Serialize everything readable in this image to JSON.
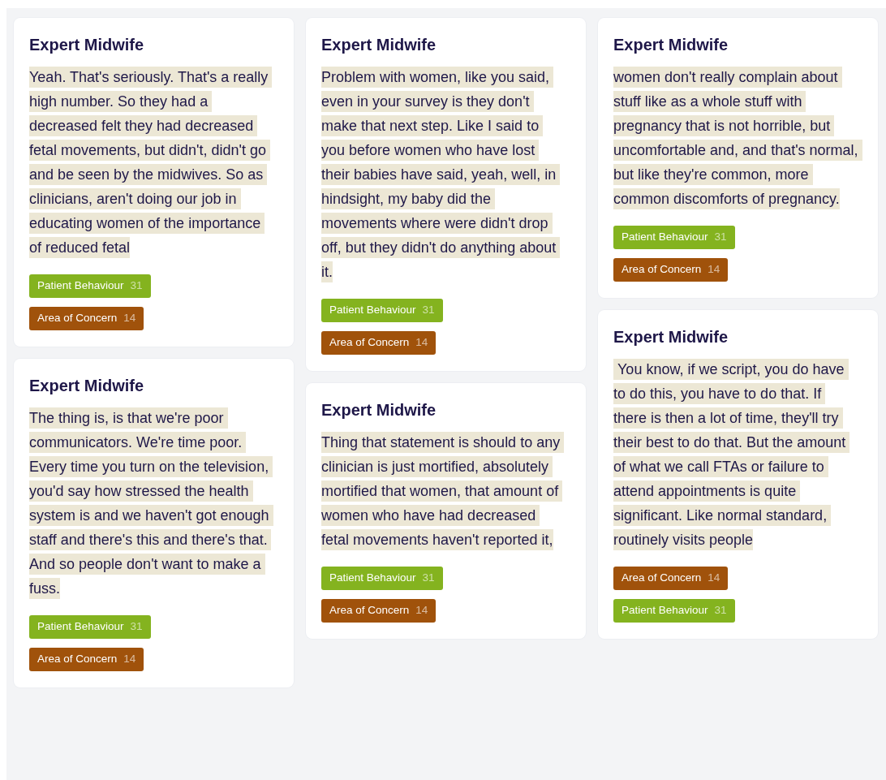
{
  "columns": [
    {
      "cards": [
        {
          "title": "Expert Midwife",
          "quote": "Yeah. That's seriously. That's a really high number. So they had a decreased felt they had decreased fetal movements, but didn't, didn't go and be seen by the midwives. So as clinicians, aren't doing our job in educating women of the importance of reduced fetal",
          "tags": [
            {
              "label": "Patient Behaviour",
              "count": "31",
              "color": "#84b31f"
            },
            {
              "label": "Area of Concern",
              "count": "14",
              "color": "#a0520b"
            }
          ]
        },
        {
          "title": "Expert Midwife",
          "quote": "The thing is, is that we're poor communicators. We're time poor. Every time you turn on the television, you'd say how stressed the health system is and we haven't got enough staff and there's this and there's that. And so people don't want to make a fuss.",
          "tags": [
            {
              "label": "Patient Behaviour",
              "count": "31",
              "color": "#84b31f"
            },
            {
              "label": "Area of Concern",
              "count": "14",
              "color": "#a0520b"
            }
          ]
        }
      ]
    },
    {
      "cards": [
        {
          "title": "Expert Midwife",
          "quote": "Problem with women, like you said, even in your survey is they don't make that next step. Like I said to you before women who have lost their babies have said, yeah, well, in hindsight, my baby did the movements where were didn't drop off, but they didn't do anything about it.",
          "tags": [
            {
              "label": "Patient Behaviour",
              "count": "31",
              "color": "#84b31f"
            },
            {
              "label": "Area of Concern",
              "count": "14",
              "color": "#a0520b"
            }
          ]
        },
        {
          "title": "Expert Midwife",
          "quote": "Thing that statement is should to any clinician is just mortified, absolutely mortified that women, that amount of women who have had decreased fetal movements haven't reported it,",
          "tags": [
            {
              "label": "Patient Behaviour",
              "count": "31",
              "color": "#84b31f"
            },
            {
              "label": "Area of Concern",
              "count": "14",
              "color": "#a0520b"
            }
          ]
        }
      ]
    },
    {
      "cards": [
        {
          "title": "Expert Midwife",
          "quote": "women don't really complain about stuff like as a whole stuff with pregnancy that is not horrible, but uncomfortable and, and that's normal, but like they're common, more common discomforts of pregnancy.",
          "tags": [
            {
              "label": "Patient Behaviour",
              "count": "31",
              "color": "#84b31f"
            },
            {
              "label": "Area of Concern",
              "count": "14",
              "color": "#a0520b"
            }
          ]
        },
        {
          "title": "Expert Midwife",
          "quote": " You know, if we script, you do have to do this, you have to do that. If there is then a lot of time, they'll try their best to do that. But the amount of what we call FTAs or failure to attend appointments is quite significant. Like normal standard, routinely visits people",
          "tags": [
            {
              "label": "Area of Concern",
              "count": "14",
              "color": "#a0520b"
            },
            {
              "label": "Patient Behaviour",
              "count": "31",
              "color": "#84b31f"
            }
          ]
        }
      ]
    }
  ]
}
